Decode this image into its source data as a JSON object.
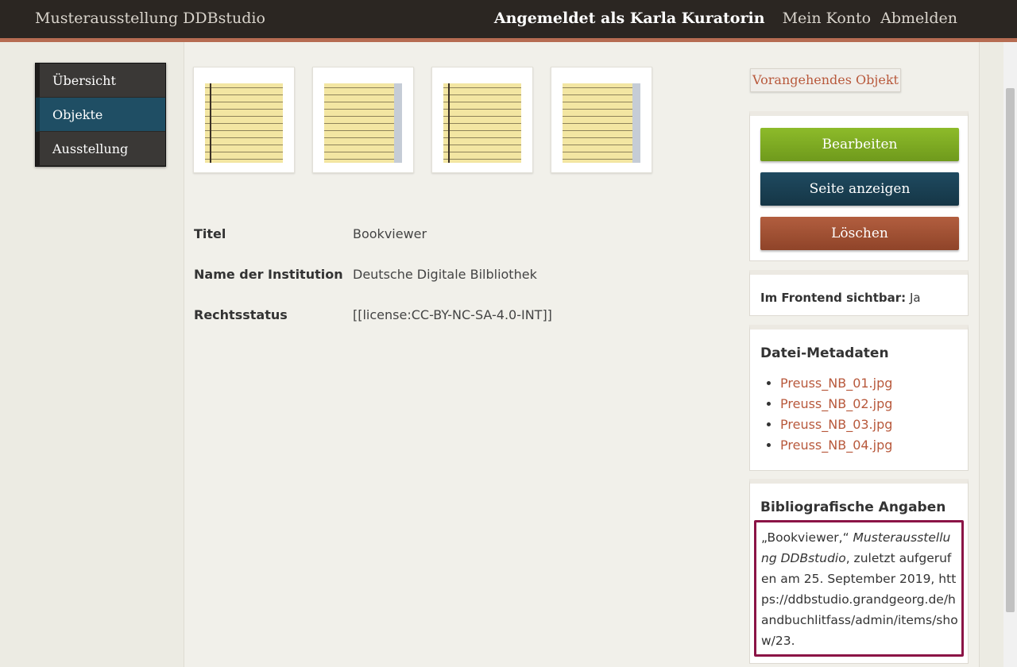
{
  "header": {
    "site_title": "Musterausstellung DDBstudio",
    "logged_in_as": "Angemeldet als Karla Kuratorin",
    "account_link": "Mein Konto",
    "logout_link": "Abmelden"
  },
  "sidebar": {
    "items": [
      {
        "label": "Übersicht"
      },
      {
        "label": "Objekte"
      },
      {
        "label": "Ausstellung"
      }
    ]
  },
  "metadata": {
    "rows": [
      {
        "label": "Titel",
        "value": "Bookviewer"
      },
      {
        "label": "Name der Institution",
        "value": "Deutsche Digitale Bilbliothek"
      },
      {
        "label": "Rechtsstatus",
        "value": "[[license:CC-BY-NC-SA-4.0-INT]]"
      }
    ]
  },
  "actions": {
    "previous": "Vorangehendes Objekt",
    "edit": "Bearbeiten",
    "view_page": "Seite anzeigen",
    "delete": "Löschen"
  },
  "visibility": {
    "label": "Im Frontend sichtbar:",
    "value": "Ja"
  },
  "file_metadata": {
    "heading": "Datei-Metadaten",
    "files": [
      "Preuss_NB_01.jpg",
      "Preuss_NB_02.jpg",
      "Preuss_NB_03.jpg",
      "Preuss_NB_04.jpg"
    ]
  },
  "citation": {
    "heading": "Bibliografische Angaben",
    "part1": "„Bookviewer,“ ",
    "italic": "Musterausstellung DDBstudio",
    "part2": ", zuletzt aufgerufen am 25. September 2019, https://ddbstudio.grandgeorg.de/handbuchlitfass/admin/items/show/23."
  },
  "colors": {
    "accent": "#b8593c",
    "nav_active": "#1f4e64",
    "edit_green": "#7ea923",
    "delete_red": "#a3533a",
    "highlight": "#8b1446"
  }
}
